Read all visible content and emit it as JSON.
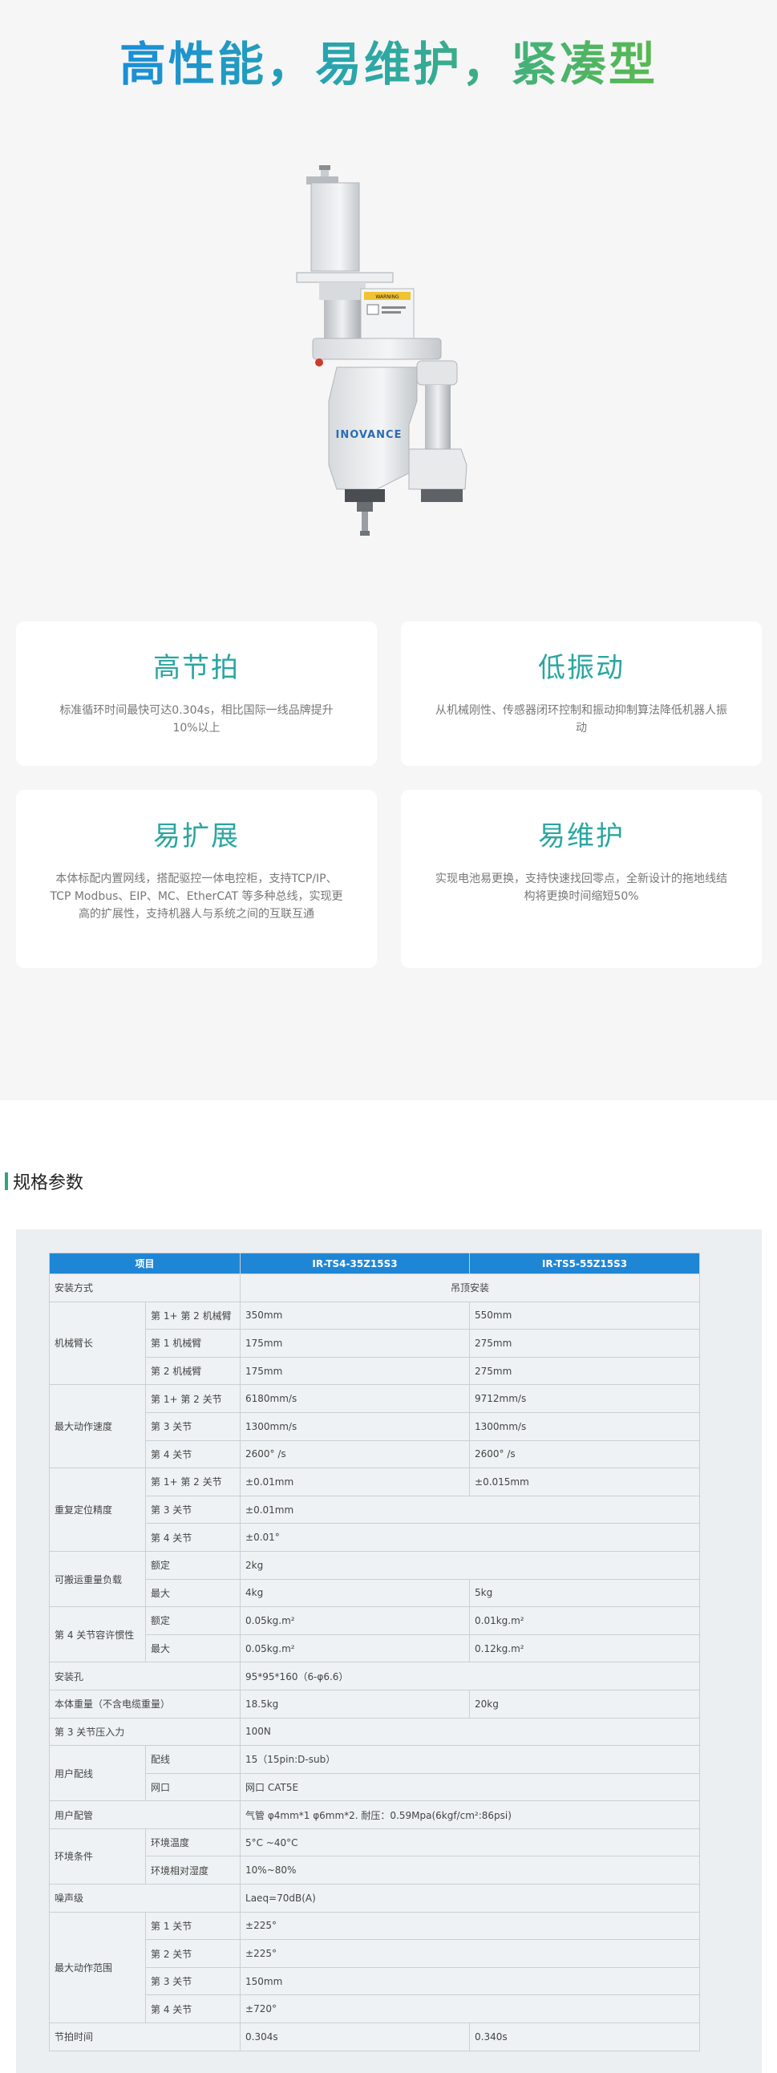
{
  "hero": {
    "title": "高性能，易维护，紧凑型",
    "robot_brand": "INOVANCE",
    "warning_label": "WARNING"
  },
  "features": [
    {
      "title": "高节拍",
      "desc": "标准循环时间最快可达0.304s，相比国际一线品牌提升10%以上"
    },
    {
      "title": "低振动",
      "desc": "从机械刚性、传感器闭环控制和振动抑制算法降低机器人振动"
    },
    {
      "title": "易扩展",
      "desc": "本体标配内置网线，搭配驱控一体电控柜，支持TCP/IP、TCP Modbus、EIP、MC、EtherCAT 等多种总线，实现更高的扩展性，支持机器人与系统之间的互联互通"
    },
    {
      "title": "易维护",
      "desc": "实现电池易更换，支持快速找回零点，全新设计的拖地线结构将更换时间缩短50%"
    }
  ],
  "spec_section": {
    "title": "规格参数",
    "headers": [
      "项目",
      "IR-TS4-35Z15S3",
      "IR-TS5-55Z15S3"
    ],
    "r_mount_label": "安装方式",
    "r_mount_val": "吊顶安装",
    "g_arm": "机械臂长",
    "r_arm12": "第 1+ 第 2 机械臂",
    "r_arm12_a": "350mm",
    "r_arm12_b": "550mm",
    "r_arm1": "第 1 机械臂",
    "r_arm1_a": "175mm",
    "r_arm1_b": "275mm",
    "r_arm2": "第 2 机械臂",
    "r_arm2_a": "175mm",
    "r_arm2_b": "275mm",
    "g_speed": "最大动作速度",
    "r_sp12": "第 1+ 第 2 关节",
    "r_sp12_a": "6180mm/s",
    "r_sp12_b": "9712mm/s",
    "r_sp3": "第 3 关节",
    "r_sp3_a": "1300mm/s",
    "r_sp3_b": "1300mm/s",
    "r_sp4": "第 4 关节",
    "r_sp4_a": "2600° /s",
    "r_sp4_b": "2600° /s",
    "g_rep": "重复定位精度",
    "r_rp12": "第 1+ 第 2 关节",
    "r_rp12_a": "±0.01mm",
    "r_rp12_b": "±0.015mm",
    "r_rp3": "第 3 关节",
    "r_rp3_v": "±0.01mm",
    "r_rp4": "第 4 关节",
    "r_rp4_v": "±0.01°",
    "g_load": "可搬运重量负载",
    "r_ld_rated": "额定",
    "r_ld_rated_v": "2kg",
    "r_ld_max": "最大",
    "r_ld_max_a": "4kg",
    "r_ld_max_b": "5kg",
    "g_inertia": "第 4 关节容许惯性",
    "r_in_rated": "额定",
    "r_in_rated_a": "0.05kg.m²",
    "r_in_rated_b": "0.01kg.m²",
    "r_in_max": "最大",
    "r_in_max_a": "0.05kg.m²",
    "r_in_max_b": "0.12kg.m²",
    "r_hole": "安装孔",
    "r_hole_v": "95*95*160（6-φ6.6）",
    "r_weight": "本体重量（不含电缆重量）",
    "r_weight_a": "18.5kg",
    "r_weight_b": "20kg",
    "r_press": "第 3 关节压入力",
    "r_press_v": "100N",
    "g_wiring": "用户配线",
    "r_wire": "配线",
    "r_wire_v": "15（15pin:D-sub）",
    "r_net": "网口",
    "r_net_v": "网口 CAT5E",
    "r_pipe": "用户配管",
    "r_pipe_v": "气管 φ4mm*1 φ6mm*2. 耐压：0.59Mpa(6kgf/cm²:86psi)",
    "g_env": "环境条件",
    "r_temp": "环境温度",
    "r_temp_v": "5°C ~40°C",
    "r_hum": "环境相对湿度",
    "r_hum_v": "10%~80%",
    "r_noise": "噪声级",
    "r_noise_v": "Laeq=70dB(A)",
    "g_range": "最大动作范围",
    "r_rg1": "第 1 关节",
    "r_rg1_v": "±225°",
    "r_rg2": "第 2 关节",
    "r_rg2_v": "±225°",
    "r_rg3": "第 3 关节",
    "r_rg3_v": "150mm",
    "r_rg4": "第 4 关节",
    "r_rg4_v": "±720°",
    "r_cycle": "节拍时间",
    "r_cycle_a": "0.304s",
    "r_cycle_b": "0.340s"
  }
}
